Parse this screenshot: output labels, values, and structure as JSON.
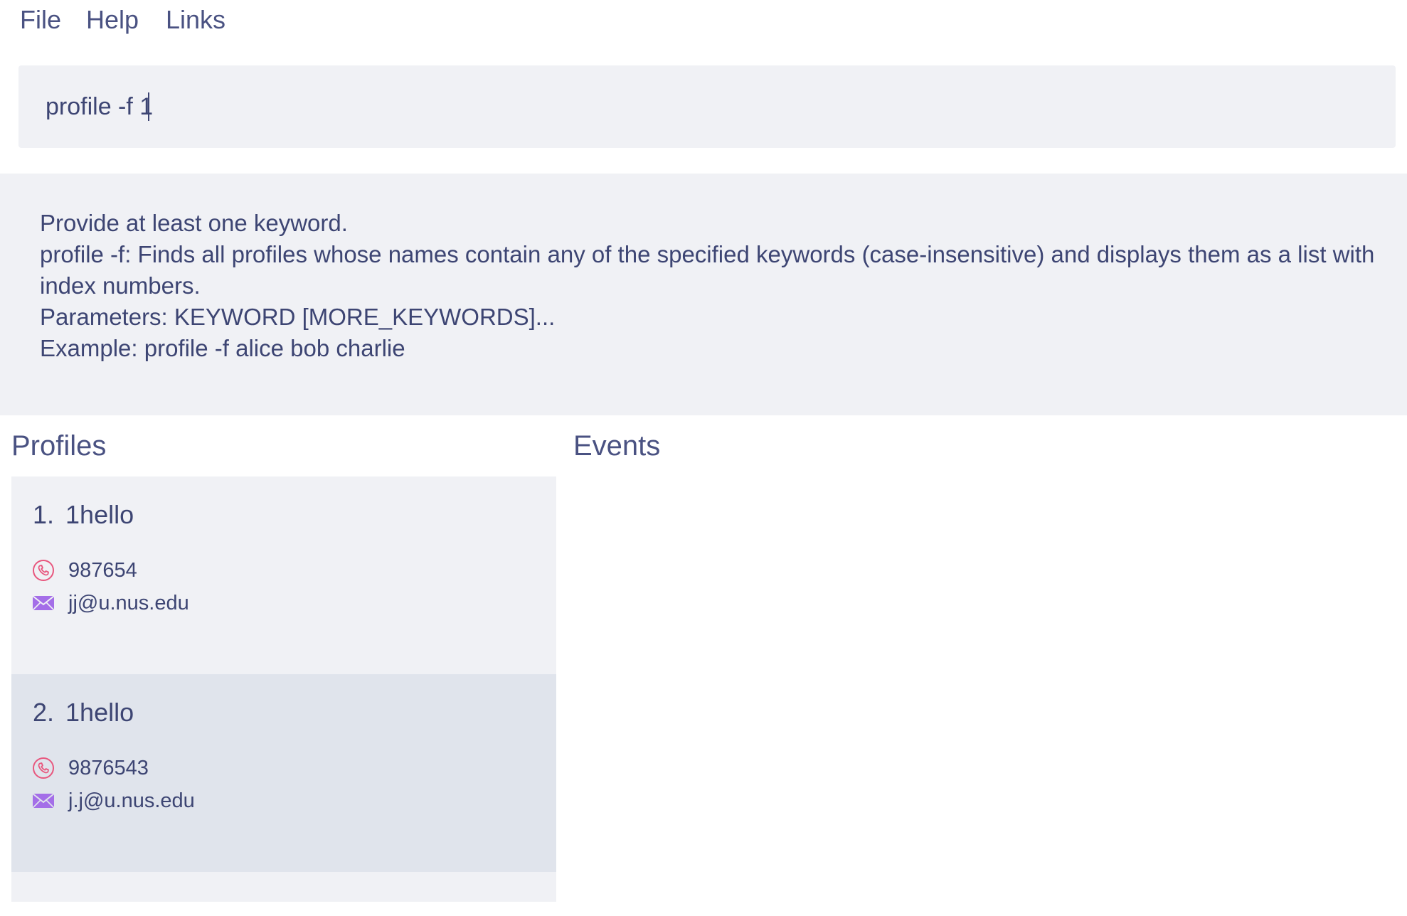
{
  "menu": {
    "items": [
      "File",
      "Help",
      "Links"
    ]
  },
  "command": {
    "value": "profile -f 1"
  },
  "result": {
    "text": "Provide at least one keyword.\nprofile -f: Finds all profiles whose names contain any of the specified keywords (case-insensitive) and displays them as a list with index numbers.\nParameters: KEYWORD [MORE_KEYWORDS]...\nExample: profile -f alice bob charlie"
  },
  "panels": {
    "profiles_title": "Profiles",
    "events_title": "Events"
  },
  "profiles": [
    {
      "index": "1.",
      "name": "1hello",
      "phone": "987654",
      "email": "jj@u.nus.edu"
    },
    {
      "index": "2.",
      "name": "1hello",
      "phone": "9876543",
      "email": "j.j@u.nus.edu"
    }
  ],
  "colors": {
    "phone_icon": "#e8577e",
    "email_icon": "#a46ee8",
    "panel_bg": "#f0f1f5",
    "selected_card_bg": "#e0e4ec",
    "text": "#3d4573"
  },
  "icons": {
    "phone": "phone-icon",
    "email": "email-icon"
  }
}
